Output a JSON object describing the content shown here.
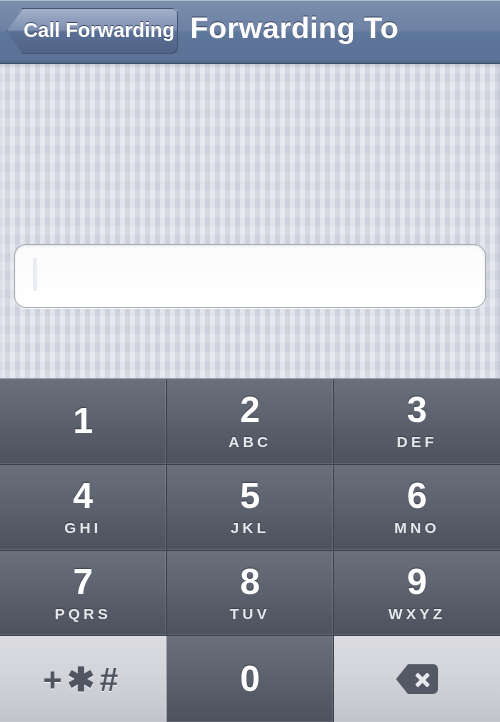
{
  "navbar": {
    "back_button_label": "Call Forwarding",
    "back_icon": "chevron-left-icon",
    "title": "Forwarding To"
  },
  "form": {
    "phone_field": {
      "value": "",
      "placeholder": "",
      "focused": true,
      "caret_visible": true
    }
  },
  "keypad": {
    "rows": [
      [
        {
          "digit": "1",
          "letters": ""
        },
        {
          "digit": "2",
          "letters": "ABC"
        },
        {
          "digit": "3",
          "letters": "DEF"
        }
      ],
      [
        {
          "digit": "4",
          "letters": "GHI"
        },
        {
          "digit": "5",
          "letters": "JKL"
        },
        {
          "digit": "6",
          "letters": "MNO"
        }
      ],
      [
        {
          "digit": "7",
          "letters": "PQRS"
        },
        {
          "digit": "8",
          "letters": "TUV"
        },
        {
          "digit": "9",
          "letters": "WXYZ"
        }
      ]
    ],
    "bottom_row": {
      "symbols_key": {
        "label": "+✱#",
        "parts": [
          "+",
          "✱",
          "#"
        ]
      },
      "zero_key": {
        "digit": "0",
        "letters": ""
      },
      "delete_key": {
        "icon": "backspace-icon",
        "label": ""
      }
    }
  },
  "colors": {
    "navbar_top": "#8496b4",
    "navbar_bottom": "#5b7296",
    "background": "#d8dbe5",
    "key_dark_top": "#69707c",
    "key_dark_bottom": "#4c535f",
    "key_light_top": "#dcdde1",
    "key_light_bottom": "#c2c4cc",
    "key_text": "#ffffff",
    "symbol_text": "#4f5662"
  }
}
